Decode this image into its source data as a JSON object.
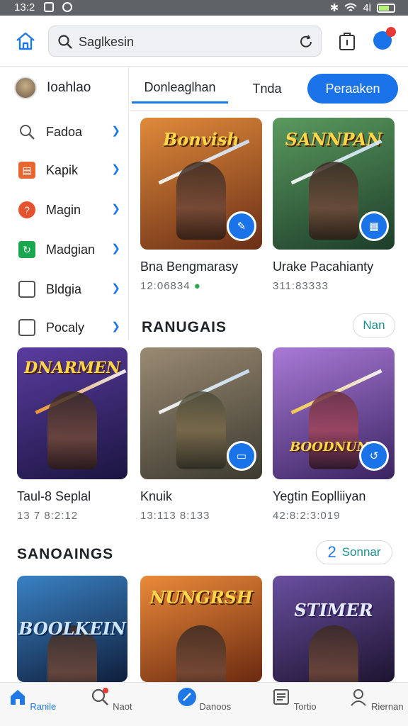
{
  "status_bar": {
    "time": "13:2",
    "signal_text": "4l"
  },
  "header": {
    "search": {
      "value": "Saglkesin",
      "placeholder": "Saglkesin"
    }
  },
  "sidebar": {
    "user_name": "Ioahlao",
    "items": [
      {
        "label": "Fadoa",
        "icon": "search-icon",
        "color": "#ffffff"
      },
      {
        "label": "Kapik",
        "icon": "image-icon",
        "color": "#e8662f"
      },
      {
        "label": "Magin",
        "icon": "help-circle-icon",
        "color": "#e5522d"
      },
      {
        "label": "Madgian",
        "icon": "refresh-icon",
        "color": "#1aa74f"
      },
      {
        "label": "Bldgia",
        "icon": "wallet-icon",
        "color": "#ffffff"
      },
      {
        "label": "Pocaly",
        "icon": "document-icon",
        "color": "#ffffff"
      }
    ]
  },
  "tabs": [
    {
      "label": "Donleaglhan",
      "active": true
    },
    {
      "label": "Tnda",
      "active": false
    },
    {
      "label": "Peraaken",
      "active": false,
      "button": true
    }
  ],
  "sections": {
    "rankings": {
      "title": "RANUGAIS",
      "action": "Nan"
    },
    "savings": {
      "title": "SANOAINGS",
      "action_number": "2",
      "action": "Sonnar"
    }
  },
  "cards_top": [
    {
      "art_title": "Bonvish",
      "title": "Bna Bengmarasy",
      "sub": "12:06834",
      "theme": [
        "#d8762f",
        "#5a2a16"
      ],
      "badge": "pen-icon"
    },
    {
      "art_title": "SANNPAN",
      "title": "Urake Pacahianty",
      "sub": "311:83333",
      "theme": [
        "#4f8a54",
        "#1d3d2a"
      ],
      "badge": "calendar-icon"
    }
  ],
  "cards_mid": [
    {
      "art_title": "DNARMEN",
      "title": "Taul-8 Seplal",
      "sub": "13 7 8:2:12",
      "theme": [
        "#4a2c86",
        "#1b1540"
      ],
      "badge": ""
    },
    {
      "art_title": "",
      "title": "Knuik",
      "sub": "13:113 8:133",
      "theme": [
        "#8a7a66",
        "#3c3a30"
      ],
      "badge": "calendar-icon"
    },
    {
      "art_title": "BOODNUNS",
      "title": "Yegtin Eoplliiyan",
      "sub": "42:8:2:3:019",
      "theme": [
        "#9a6bd0",
        "#3a2462"
      ],
      "badge": "chat-icon"
    }
  ],
  "cards_bottom": [
    {
      "art_title": "BOOLKEIN",
      "theme": [
        "#2e6fb0",
        "#0f1f3c"
      ]
    },
    {
      "art_title": "NUNGRSH",
      "theme": [
        "#e2782f",
        "#6b2a10"
      ]
    },
    {
      "art_title": "STIMER",
      "theme": [
        "#5a3f8f",
        "#1d1430"
      ]
    }
  ],
  "bottom_nav": [
    {
      "label": "Ranile",
      "icon": "home-icon",
      "active": true
    },
    {
      "label": "Naot",
      "icon": "search-icon",
      "active": false
    },
    {
      "label": "Danoos",
      "icon": "compass-icon",
      "active": false
    },
    {
      "label": "Tortio",
      "icon": "news-icon",
      "active": false
    },
    {
      "label": "Riernan",
      "icon": "profile-icon",
      "active": false
    }
  ],
  "colors": {
    "accent": "#1a73e8",
    "teal_text": "#1b8f8a"
  }
}
